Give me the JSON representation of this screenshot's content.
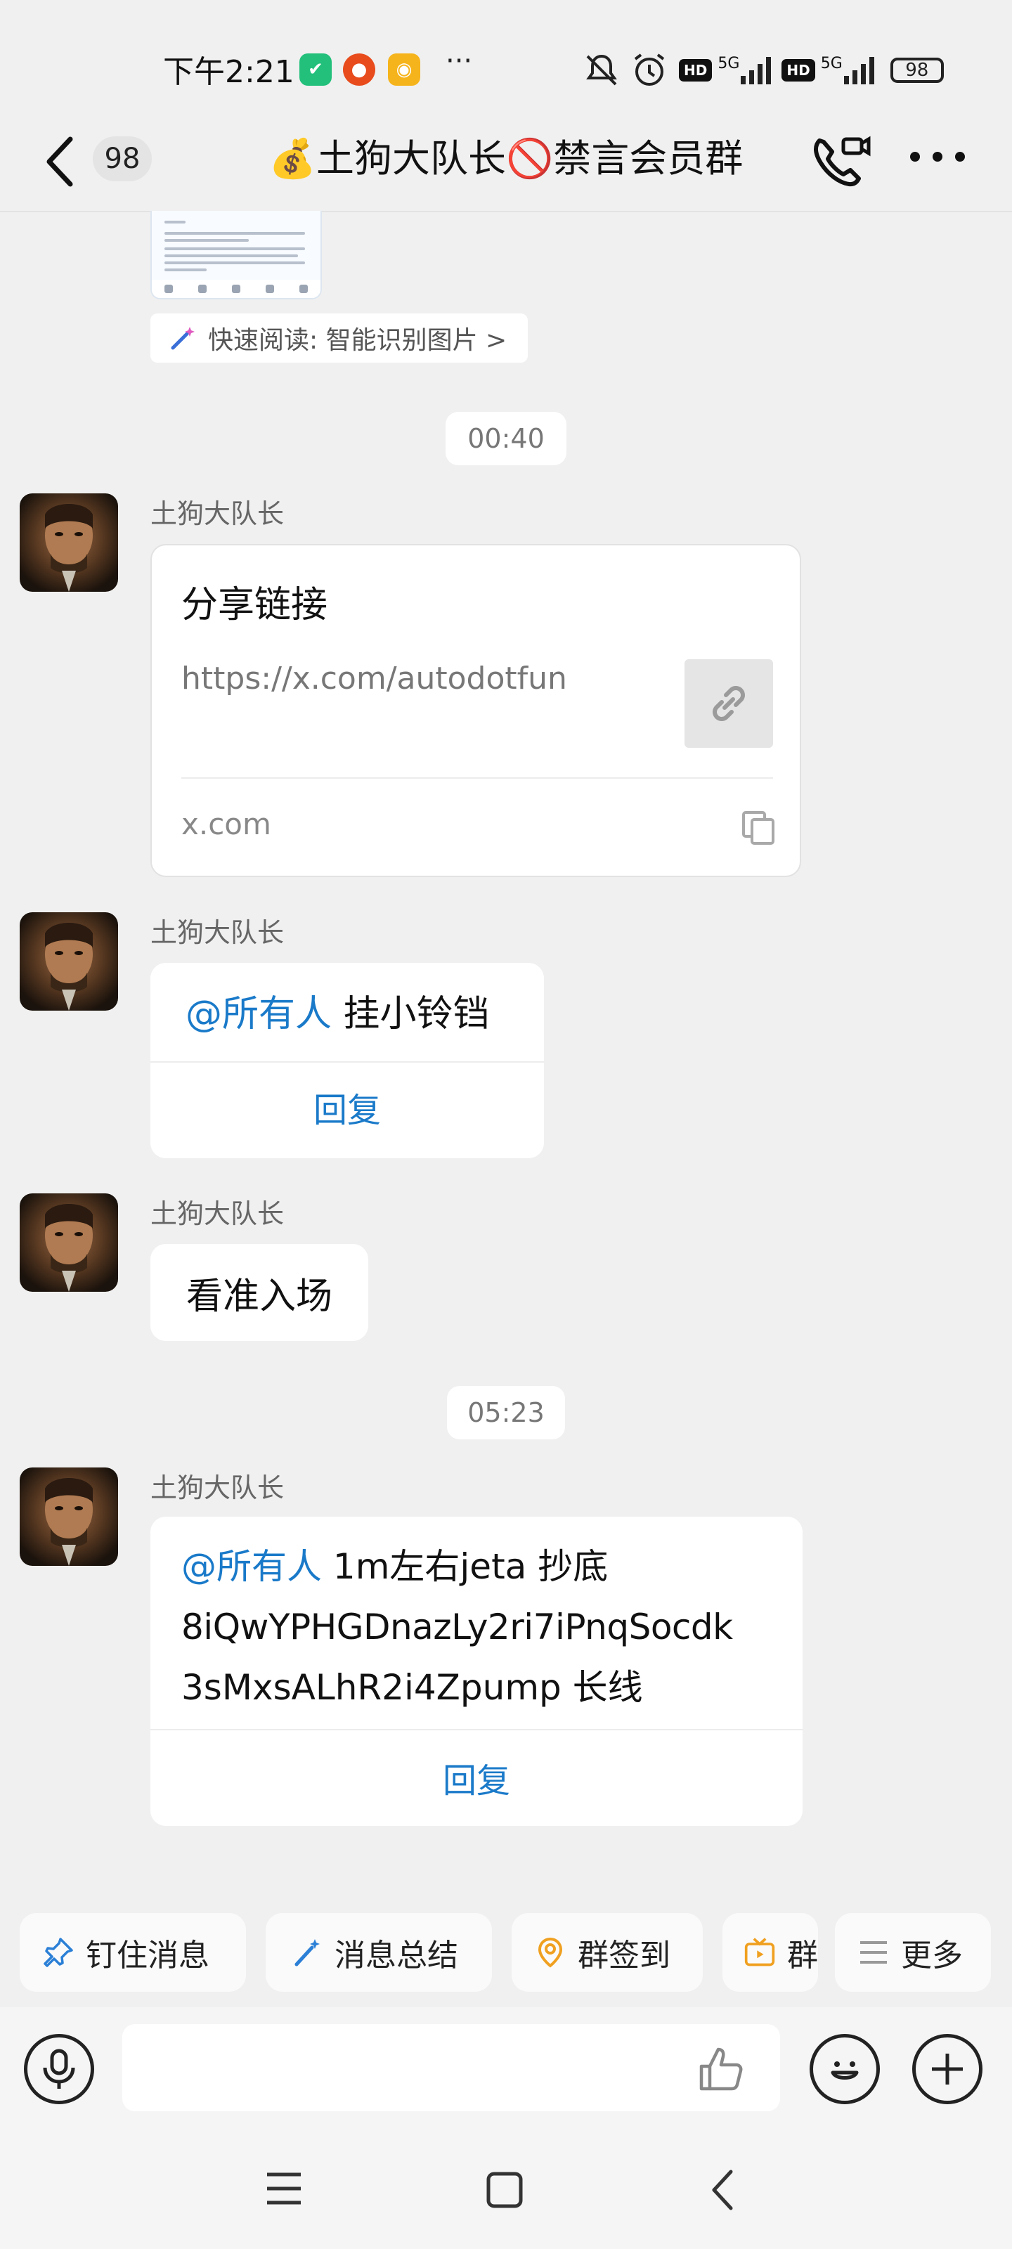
{
  "status_bar": {
    "time": "下午2:21",
    "dots": "···",
    "network": "5G",
    "hd": "HD",
    "battery": "98"
  },
  "nav": {
    "unread_count": "98",
    "title": "💰土狗大队长🚫禁言会员群"
  },
  "top_image": {
    "quick_read": "快速阅读: 智能识别图片 >"
  },
  "messages": [
    {
      "time": "00:40",
      "sender": "土狗大队长",
      "type": "link_card",
      "card_title": "分享链接",
      "card_url": "https://x.com/autodotfun",
      "card_domain": "x.com"
    },
    {
      "sender": "土狗大队长",
      "type": "announcement",
      "mention": "@所有人",
      "text": " 挂小铃铛",
      "reply_label": "回复"
    },
    {
      "sender": "土狗大队长",
      "type": "text",
      "text": "看准入场"
    },
    {
      "time": "05:23",
      "sender": "土狗大队长",
      "type": "announcement",
      "mention": "@所有人",
      "text_line1": " 1m左右jeta 抄底",
      "text_line2": "8iQwYPHGDnazLy2ri7iPnqSocdk",
      "text_line3": "3sMxsALhR2i4Zpump 长线",
      "reply_label": "回复"
    }
  ],
  "quick_actions": [
    {
      "label": "钉住消息",
      "icon": "pin-icon"
    },
    {
      "label": "消息总结",
      "icon": "magic-wand-icon"
    },
    {
      "label": "群签到",
      "icon": "checkin-icon"
    },
    {
      "label": "群",
      "icon": "tv-icon"
    },
    {
      "label": "更多",
      "icon": "menu-icon"
    }
  ],
  "colors": {
    "accent": "#1a7ac9",
    "background": "#f0f0f0",
    "bubble": "#ffffff"
  }
}
